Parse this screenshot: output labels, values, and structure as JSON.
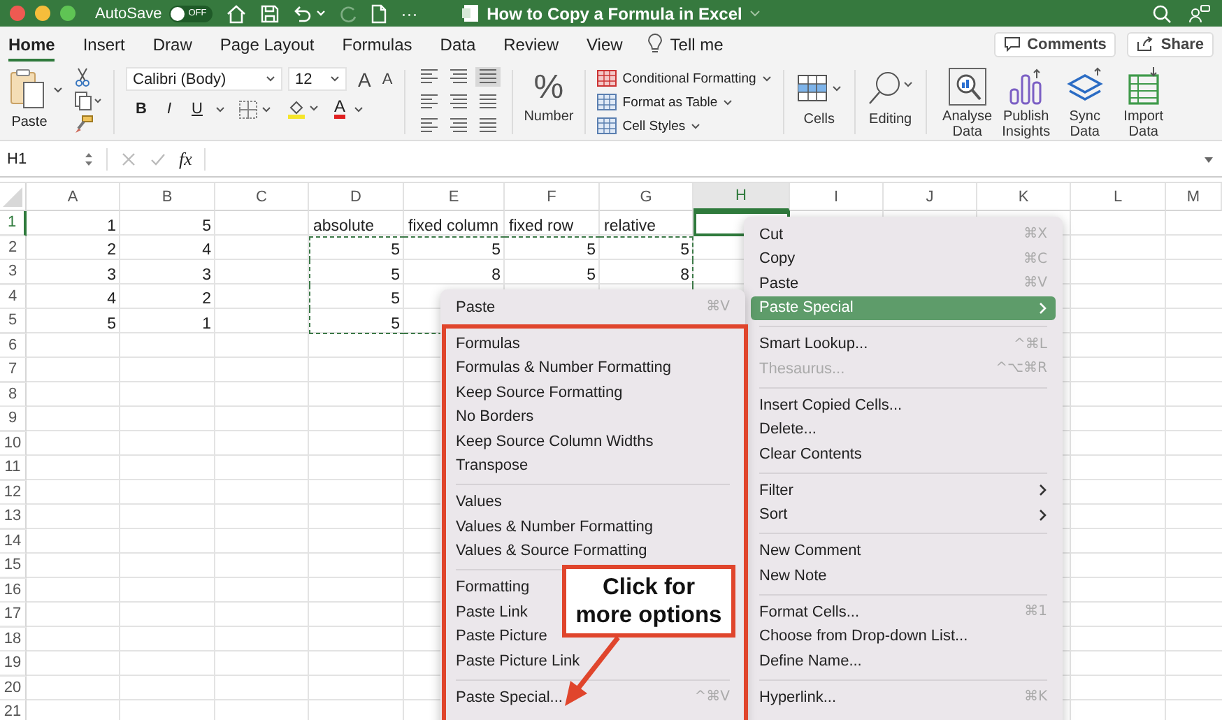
{
  "title_bar": {
    "autosave": {
      "label": "AutoSave",
      "on": false,
      "state_text": "OFF"
    },
    "more": "···",
    "title": "How to Copy a Formula in Excel"
  },
  "tabs": [
    {
      "label": "Home",
      "selected": true
    },
    {
      "label": "Insert",
      "selected": false
    },
    {
      "label": "Draw",
      "selected": false
    },
    {
      "label": "Page Layout",
      "selected": false
    },
    {
      "label": "Formulas",
      "selected": false
    },
    {
      "label": "Data",
      "selected": false
    },
    {
      "label": "Review",
      "selected": false
    },
    {
      "label": "View",
      "selected": false
    }
  ],
  "tell_me": "Tell me",
  "comments": "Comments",
  "share": "Share",
  "ribbon": {
    "paste": "Paste",
    "font_family": "Calibri (Body)",
    "font_size": "12",
    "font_size_buttons": [
      "A",
      "A"
    ],
    "format_buttons": [
      "B",
      "I",
      "U"
    ],
    "font_color": "A",
    "number": {
      "glyph": "%",
      "label": "Number"
    },
    "styles": [
      "Conditional Formatting",
      "Format as Table",
      "Cell Styles"
    ],
    "cells": "Cells",
    "editing": "Editing",
    "add_ins": [
      {
        "label": "Analyse Data",
        "kind": "analyse"
      },
      {
        "label": "Publish Insights",
        "kind": "publish"
      },
      {
        "label": "Sync Data",
        "kind": "sync"
      },
      {
        "label": "Import Data",
        "kind": "import"
      }
    ]
  },
  "formula_bar": {
    "name_box": "H1",
    "fx": "fx"
  },
  "column_headers": [
    {
      "label": "A",
      "selected": false,
      "copied": false
    },
    {
      "label": "B",
      "selected": false,
      "copied": false
    },
    {
      "label": "C",
      "selected": false,
      "copied": false
    },
    {
      "label": "D",
      "selected": false,
      "copied": true
    },
    {
      "label": "E",
      "selected": false,
      "copied": true
    },
    {
      "label": "F",
      "selected": false,
      "copied": true
    },
    {
      "label": "G",
      "selected": false,
      "copied": true
    },
    {
      "label": "H",
      "selected": true,
      "copied": false
    },
    {
      "label": "I",
      "selected": false,
      "copied": false
    },
    {
      "label": "J",
      "selected": false,
      "copied": false
    },
    {
      "label": "K",
      "selected": false,
      "copied": false
    },
    {
      "label": "L",
      "selected": false,
      "copied": false
    },
    {
      "label": "M",
      "selected": false,
      "copied": false
    }
  ],
  "rows": [
    {
      "number": "1",
      "selected": true,
      "copied": false,
      "cells": [
        {
          "text": "1",
          "kind": "number"
        },
        {
          "text": "5",
          "kind": "number"
        },
        {},
        {
          "text": "absolute",
          "kind": "text"
        },
        {
          "text": "fixed column",
          "kind": "text"
        },
        {
          "text": "fixed row",
          "kind": "text"
        },
        {
          "text": "relative",
          "kind": "text"
        }
      ]
    },
    {
      "number": "2",
      "selected": false,
      "copied": true,
      "cells": [
        {
          "text": "2",
          "kind": "number"
        },
        {
          "text": "4",
          "kind": "number"
        },
        {},
        {
          "text": "5",
          "kind": "number"
        },
        {
          "text": "5",
          "kind": "number"
        },
        {
          "text": "5",
          "kind": "number"
        },
        {
          "text": "5",
          "kind": "number"
        }
      ]
    },
    {
      "number": "3",
      "selected": false,
      "copied": true,
      "cells": [
        {
          "text": "3",
          "kind": "number"
        },
        {
          "text": "3",
          "kind": "number"
        },
        {},
        {
          "text": "5",
          "kind": "number"
        },
        {
          "text": "8",
          "kind": "number"
        },
        {
          "text": "5",
          "kind": "number"
        },
        {
          "text": "8",
          "kind": "number"
        }
      ]
    },
    {
      "number": "4",
      "selected": false,
      "copied": true,
      "cells": [
        {
          "text": "4",
          "kind": "number"
        },
        {
          "text": "2",
          "kind": "number"
        },
        {},
        {
          "text": "5",
          "kind": "number"
        }
      ]
    },
    {
      "number": "5",
      "selected": false,
      "copied": true,
      "cells": [
        {
          "text": "5",
          "kind": "number"
        },
        {
          "text": "1",
          "kind": "number"
        },
        {},
        {
          "text": "5",
          "kind": "number"
        }
      ]
    },
    {
      "number": "6",
      "selected": false,
      "copied": false,
      "cells": []
    },
    {
      "number": "7",
      "selected": false,
      "copied": false,
      "cells": []
    },
    {
      "number": "8",
      "selected": false,
      "copied": false,
      "cells": []
    },
    {
      "number": "9",
      "selected": false,
      "copied": false,
      "cells": []
    },
    {
      "number": "10",
      "selected": false,
      "copied": false,
      "cells": []
    },
    {
      "number": "11",
      "selected": false,
      "copied": false,
      "cells": []
    },
    {
      "number": "12",
      "selected": false,
      "copied": false,
      "cells": []
    },
    {
      "number": "13",
      "selected": false,
      "copied": false,
      "cells": []
    },
    {
      "number": "14",
      "selected": false,
      "copied": false,
      "cells": []
    },
    {
      "number": "15",
      "selected": false,
      "copied": false,
      "cells": []
    },
    {
      "number": "16",
      "selected": false,
      "copied": false,
      "cells": []
    },
    {
      "number": "17",
      "selected": false,
      "copied": false,
      "cells": []
    },
    {
      "number": "18",
      "selected": false,
      "copied": false,
      "cells": []
    },
    {
      "number": "19",
      "selected": false,
      "copied": false,
      "cells": []
    },
    {
      "number": "20",
      "selected": false,
      "copied": false,
      "cells": []
    },
    {
      "number": "21",
      "selected": false,
      "copied": false,
      "cells": []
    }
  ],
  "paste_menu": {
    "items": [
      {
        "kind": "item",
        "label": "Paste",
        "shortcut": "⌘V"
      },
      {
        "kind": "separator"
      },
      {
        "kind": "item",
        "label": "Formulas"
      },
      {
        "kind": "item",
        "label": "Formulas & Number Formatting"
      },
      {
        "kind": "item",
        "label": "Keep Source Formatting"
      },
      {
        "kind": "item",
        "label": "No Borders"
      },
      {
        "kind": "item",
        "label": "Keep Source Column Widths"
      },
      {
        "kind": "item",
        "label": "Transpose"
      },
      {
        "kind": "separator"
      },
      {
        "kind": "item",
        "label": "Values"
      },
      {
        "kind": "item",
        "label": "Values & Number Formatting"
      },
      {
        "kind": "item",
        "label": "Values & Source Formatting"
      },
      {
        "kind": "separator"
      },
      {
        "kind": "item",
        "label": "Formatting"
      },
      {
        "kind": "item",
        "label": "Paste Link"
      },
      {
        "kind": "item",
        "label": "Paste Picture"
      },
      {
        "kind": "item",
        "label": "Paste Picture Link"
      },
      {
        "kind": "separator"
      },
      {
        "kind": "item",
        "label": "Paste Special...",
        "shortcut": "^⌘V"
      }
    ]
  },
  "context_menu": {
    "items": [
      {
        "kind": "item",
        "label": "Cut",
        "shortcut": "⌘X",
        "selected": false,
        "disabled": false,
        "submenu": false
      },
      {
        "kind": "item",
        "label": "Copy",
        "shortcut": "⌘C",
        "selected": false,
        "disabled": false,
        "submenu": false
      },
      {
        "kind": "item",
        "label": "Paste",
        "shortcut": "⌘V",
        "selected": false,
        "disabled": false,
        "submenu": false
      },
      {
        "kind": "item",
        "label": "Paste Special",
        "selected": true,
        "disabled": false,
        "submenu": true
      },
      {
        "kind": "separator"
      },
      {
        "kind": "item",
        "label": "Smart Lookup...",
        "shortcut": "^⌘L",
        "selected": false,
        "disabled": false,
        "submenu": false
      },
      {
        "kind": "item",
        "label": "Thesaurus...",
        "shortcut": "^⌥⌘R",
        "selected": false,
        "disabled": true,
        "submenu": false
      },
      {
        "kind": "separator"
      },
      {
        "kind": "item",
        "label": "Insert Copied Cells...",
        "selected": false,
        "disabled": false,
        "submenu": false
      },
      {
        "kind": "item",
        "label": "Delete...",
        "selected": false,
        "disabled": false,
        "submenu": false
      },
      {
        "kind": "item",
        "label": "Clear Contents",
        "selected": false,
        "disabled": false,
        "submenu": false
      },
      {
        "kind": "separator"
      },
      {
        "kind": "item",
        "label": "Filter",
        "selected": false,
        "disabled": false,
        "submenu": true
      },
      {
        "kind": "item",
        "label": "Sort",
        "selected": false,
        "disabled": false,
        "submenu": true
      },
      {
        "kind": "separator"
      },
      {
        "kind": "item",
        "label": "New Comment",
        "selected": false,
        "disabled": false,
        "submenu": false
      },
      {
        "kind": "item",
        "label": "New Note",
        "selected": false,
        "disabled": false,
        "submenu": false
      },
      {
        "kind": "separator"
      },
      {
        "kind": "item",
        "label": "Format Cells...",
        "shortcut": "⌘1",
        "selected": false,
        "disabled": false,
        "submenu": false
      },
      {
        "kind": "item",
        "label": "Choose from Drop-down List...",
        "selected": false,
        "disabled": false,
        "submenu": false
      },
      {
        "kind": "item",
        "label": "Define Name...",
        "selected": false,
        "disabled": false,
        "submenu": false
      },
      {
        "kind": "separator"
      },
      {
        "kind": "item",
        "label": "Hyperlink...",
        "shortcut": "⌘K",
        "selected": false,
        "disabled": false,
        "submenu": false
      }
    ]
  },
  "annotation": {
    "callout": "Click for\nmore options"
  }
}
